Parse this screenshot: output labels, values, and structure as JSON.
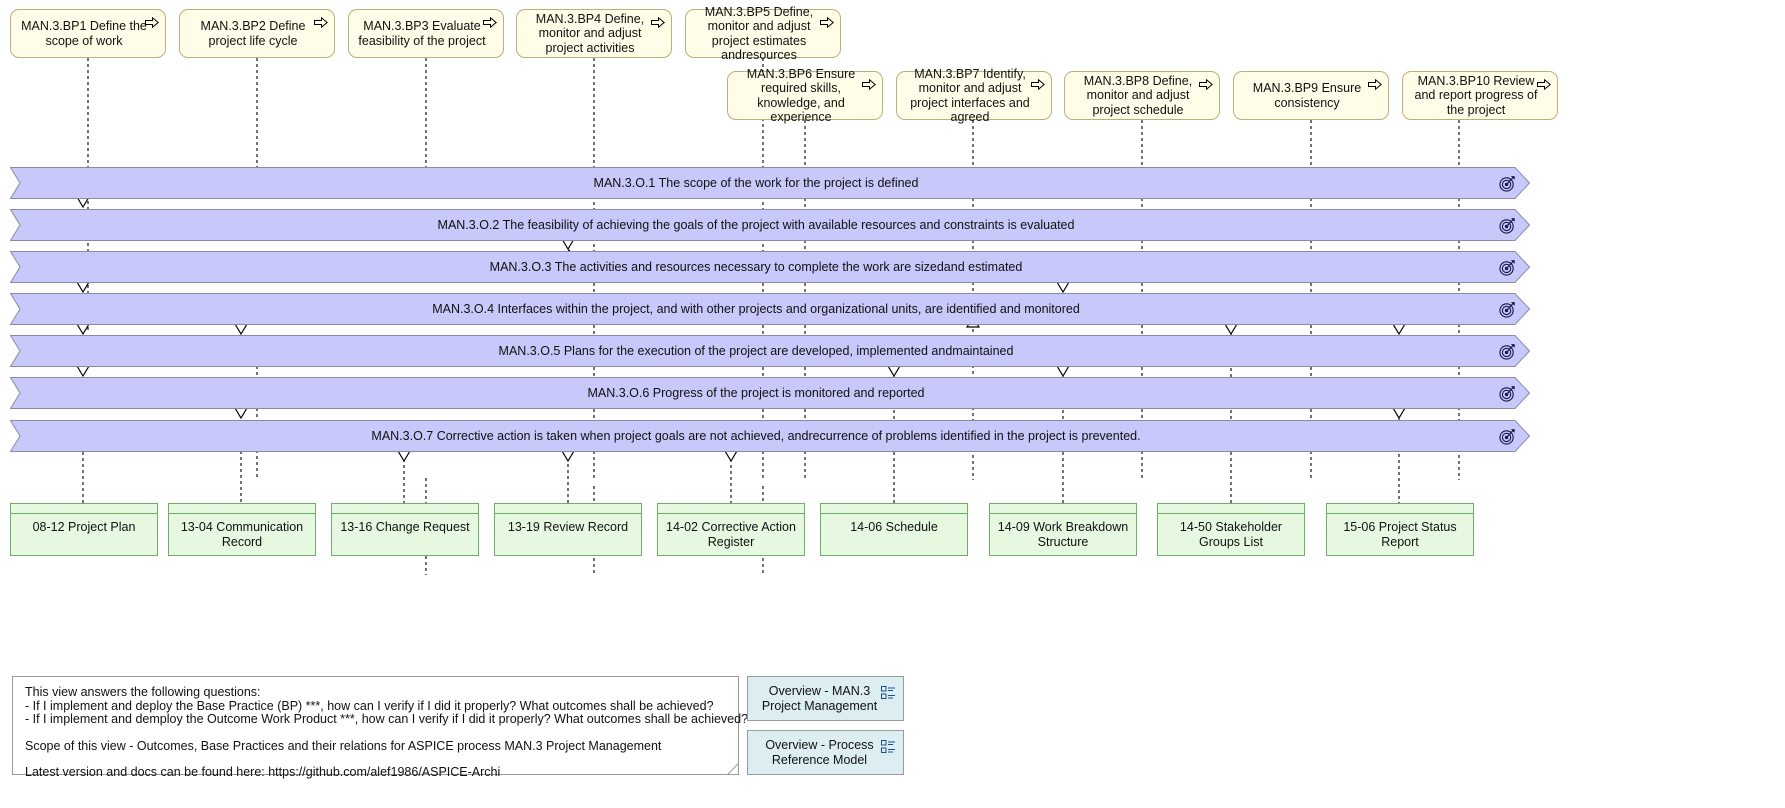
{
  "diagram": {
    "title": "Overview - MAN.3 Project Management",
    "colors": {
      "process_fill": "#fffde8",
      "process_stroke": "#b3b37a",
      "goal_fill": "#c8c8fa",
      "goal_stroke": "#8a8aa8",
      "deliverable_fill": "#e6f9e0",
      "deliverable_stroke": "#6fae66",
      "view_fill": "#ddeef3",
      "note_stroke": "#9a9a9a",
      "connector": "#000000"
    }
  },
  "base_practices": [
    {
      "id": "bp1",
      "label": "MAN.3.BP1 Define the scope of work",
      "icon": "process-arrow-icon"
    },
    {
      "id": "bp2",
      "label": "MAN.3.BP2 Define project life cycle",
      "icon": "process-arrow-icon"
    },
    {
      "id": "bp3",
      "label": "MAN.3.BP3 Evaluate feasibility of the project",
      "icon": "process-arrow-icon"
    },
    {
      "id": "bp4",
      "label": "MAN.3.BP4 Define, monitor and adjust project activities",
      "icon": "process-arrow-icon"
    },
    {
      "id": "bp5",
      "label": "MAN.3.BP5 Define, monitor and adjust project estimates andresources",
      "icon": "process-arrow-icon"
    },
    {
      "id": "bp6",
      "label": "MAN.3.BP6 Ensure required skills, knowledge, and experience",
      "icon": "process-arrow-icon"
    },
    {
      "id": "bp7",
      "label": "MAN.3.BP7  Identify, monitor and adjust project interfaces and agreed",
      "icon": "process-arrow-icon"
    },
    {
      "id": "bp8",
      "label": "MAN.3.BP8 Define, monitor and adjust project schedule",
      "icon": "process-arrow-icon"
    },
    {
      "id": "bp9",
      "label": "MAN.3.BP9 Ensure consistency",
      "icon": "process-arrow-icon"
    },
    {
      "id": "bp10",
      "label": "MAN.3.BP10 Review and report progress of the project",
      "icon": "process-arrow-icon"
    }
  ],
  "outcomes": [
    {
      "id": "o1",
      "label": "MAN.3.O.1 The scope of the work for the project is defined",
      "icon": "goal-target-icon"
    },
    {
      "id": "o2",
      "label": "MAN.3.O.2 The feasibility of achieving the goals of the project with available resources and constraints is evaluated",
      "icon": "goal-target-icon"
    },
    {
      "id": "o3",
      "label": "MAN.3.O.3 The activities and resources necessary to complete the work are sizedand estimated",
      "icon": "goal-target-icon"
    },
    {
      "id": "o4",
      "label": "MAN.3.O.4 Interfaces within the project, and with other projects and organizational units, are identified and monitored",
      "icon": "goal-target-icon"
    },
    {
      "id": "o5",
      "label": "MAN.3.O.5 Plans for the execution of the project are developed, implemented andmaintained",
      "icon": "goal-target-icon"
    },
    {
      "id": "o6",
      "label": "MAN.3.O.6 Progress of the project is monitored and reported",
      "icon": "goal-target-icon"
    },
    {
      "id": "o7",
      "label": "MAN.3.O.7 Corrective action is taken when project goals are not achieved, andrecurrence of problems identified in the project is prevented.",
      "icon": "goal-target-icon"
    }
  ],
  "work_products": [
    {
      "id": "wp1",
      "label": "08-12 Project Plan"
    },
    {
      "id": "wp2",
      "label": "13-04 Communication Record"
    },
    {
      "id": "wp3",
      "label": "13-16 Change Request"
    },
    {
      "id": "wp4",
      "label": "13-19 Review Record"
    },
    {
      "id": "wp5",
      "label": "14-02 Corrective Action Register"
    },
    {
      "id": "wp6",
      "label": "14-06 Schedule"
    },
    {
      "id": "wp7",
      "label": "14-09 Work Breakdown Structure"
    },
    {
      "id": "wp8",
      "label": "14-50 Stakeholder Groups List"
    },
    {
      "id": "wp9",
      "label": "15-06 Project Status Report"
    }
  ],
  "note": {
    "line1": "This view answers the following questions:",
    "line2": "- If I implement and deploy the Base Practice (BP) ***, how can I verify if I did it properly? What outcomes shall be achieved?",
    "line3": "- If I implement and demploy the Outcome Work Product ***, how can I verify if I did it properly? What outcomes shall be achieved?",
    "line4": "Scope of this view - Outcomes, Base Practices and their relations for ASPICE process MAN.3 Project Management",
    "line5": "Latest version and docs can be found here: https://github.com/alef1986/ASPICE-Archi"
  },
  "view_refs": [
    {
      "id": "ref1",
      "label": "Overview - MAN.3 Project Management",
      "icon": "view-list-icon"
    },
    {
      "id": "ref2",
      "label": "Overview - Process Reference Model",
      "icon": "view-list-icon"
    }
  ]
}
